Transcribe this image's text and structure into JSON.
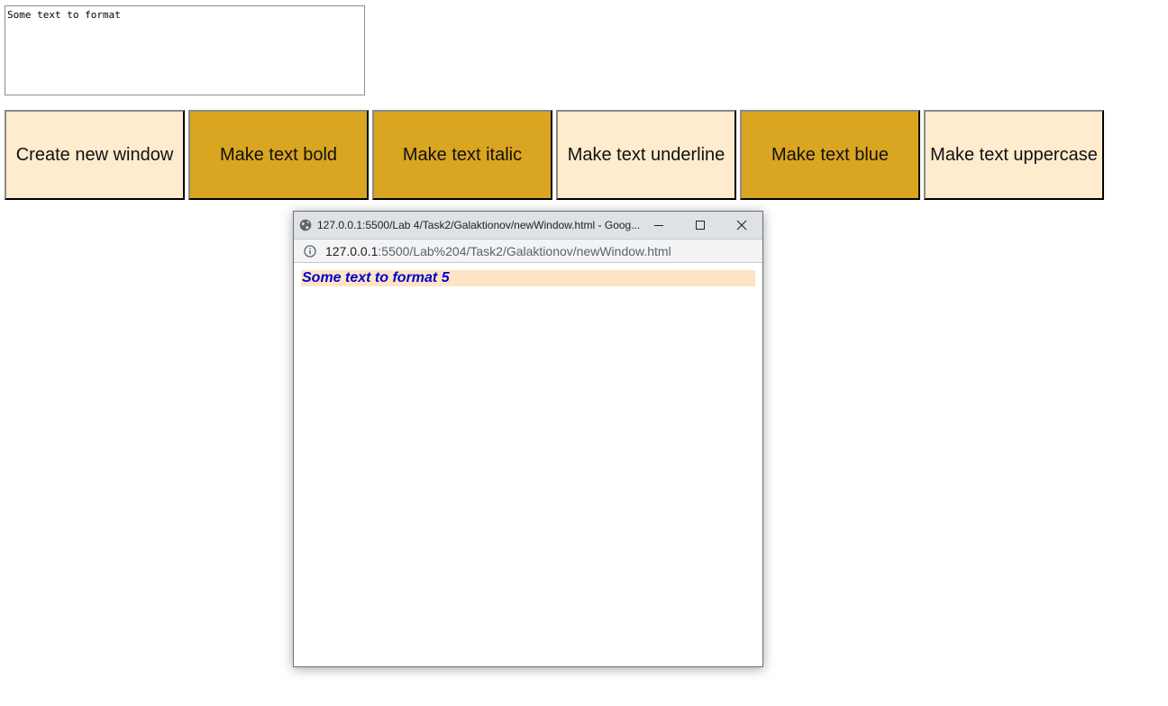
{
  "main": {
    "textarea_value": "Some text to format",
    "buttons": [
      {
        "label": "Create new window",
        "style": "light"
      },
      {
        "label": "Make text bold",
        "style": "gold"
      },
      {
        "label": "Make text italic",
        "style": "gold"
      },
      {
        "label": "Make text underline",
        "style": "light"
      },
      {
        "label": "Make text blue",
        "style": "gold"
      },
      {
        "label": "Make text uppercase",
        "style": "light"
      }
    ],
    "colors": {
      "light_button": "#ffebcd",
      "gold_button": "#daa520"
    }
  },
  "popup": {
    "title": "127.0.0.1:5500/Lab 4/Task2/Galaktionov/newWindow.html - Goog...",
    "url_host": "127.0.0.1",
    "url_rest": ":5500/Lab%204/Task2/Galaktionov/newWindow.html",
    "icons": {
      "title_icon": "globe-icon",
      "address_icon": "info-icon",
      "minimize": "minimize-icon",
      "maximize": "maximize-icon",
      "close": "close-icon"
    },
    "content_text": "Some text to format 5",
    "colors": {
      "text": "#0000cd",
      "background": "#ffe4c4"
    }
  }
}
